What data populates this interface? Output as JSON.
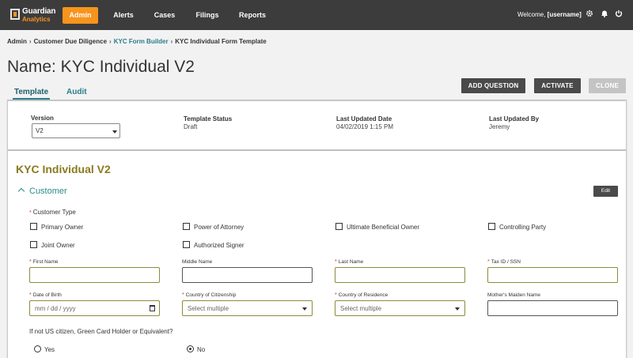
{
  "app": {
    "logo_line1": "Guardian",
    "logo_line2": "Analytics",
    "nav": [
      {
        "label": "Admin",
        "active": true
      },
      {
        "label": "Alerts"
      },
      {
        "label": "Cases"
      },
      {
        "label": "Filings"
      },
      {
        "label": "Reports"
      }
    ],
    "welcome_prefix": "Welcome,",
    "username": "[username]",
    "icons": [
      "gear-icon",
      "bell-icon",
      "power-icon"
    ]
  },
  "breadcrumb": [
    "Admin",
    "Customer Due Diligence",
    "KYC Form Builder",
    "KYC Individual Form Template"
  ],
  "page": {
    "title": "Name: KYC Individual V2",
    "tabs": [
      {
        "label": "Template",
        "active": true
      },
      {
        "label": "Audit"
      }
    ],
    "actions": [
      {
        "label": "ADD QUESTION",
        "enabled": true
      },
      {
        "label": "ACTIVATE",
        "enabled": true
      },
      {
        "label": "CLONE",
        "enabled": false
      }
    ]
  },
  "meta": {
    "version_label": "Version",
    "version_value": "V2",
    "status_label": "Template Status",
    "status_value": "Draft",
    "updated_date_label": "Last Updated Date",
    "updated_date_value": "04/02/2019 1:15 PM",
    "updated_by_label": "Last Updated By",
    "updated_by_value": "Jeremy"
  },
  "form": {
    "title": "KYC Individual V2",
    "section": "Customer",
    "edit_label": "Edit",
    "customer_type_label": "Customer Type",
    "customer_types": [
      "Primary Owner",
      "Power of Attorney",
      "Ultimate Beneficial Owner",
      "Controlling Party",
      "Joint Owner",
      "Authorized Signer"
    ],
    "fields_row1": [
      {
        "label": "First Name",
        "required": true
      },
      {
        "label": "Middle Name",
        "required": false
      },
      {
        "label": "Last Name",
        "required": true
      },
      {
        "label": "Tax ID / SSN",
        "required": true
      }
    ],
    "fields_row2": [
      {
        "label": "Date of Birth",
        "required": true,
        "placeholder": "mm / dd / yyyy"
      },
      {
        "label": "Country of Citizenship",
        "required": true,
        "placeholder": "Select multiple"
      },
      {
        "label": "Country of Residence",
        "required": true,
        "placeholder": "Select multiple"
      },
      {
        "label": "Mother's Maiden Name",
        "required": false
      }
    ],
    "green_card_question": "If not US citizen, Green Card Holder or Equivalent?",
    "radio_yes": "Yes",
    "radio_no": "No",
    "radio_selected": "No"
  },
  "colors": {
    "accent_orange": "#f7941d",
    "teal": "#2a7d8c",
    "title_gold": "#8a7a1e",
    "nav_bg": "#3c3c3c"
  }
}
